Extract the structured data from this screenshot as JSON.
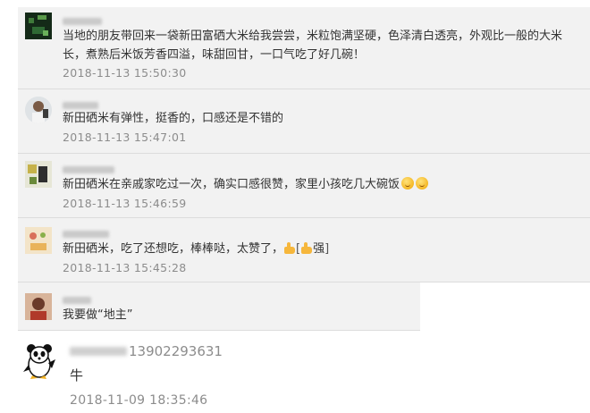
{
  "comments": [
    {
      "text": "当地的朋友带回来一袋新田富硒大米给我尝尝，米粒饱满坚硬，色泽清白透亮，外观比一般的大米长，煮熟后米饭芳香四溢，味甜回甘，一口气吃了好几碗！",
      "time": "2018-11-13 15:50:30"
    },
    {
      "text": "新田硒米有弹性，挺香的，口感还是不错的",
      "time": "2018-11-13 15:47:01"
    },
    {
      "text": "新田硒米在亲戚家吃过一次，确实口感很赞，家里小孩吃几大碗饭",
      "time": "2018-11-13 15:46:59"
    },
    {
      "text": "新田硒米，吃了还想吃，棒棒哒，太赞了，",
      "reaction_text": "强",
      "time": "2018-11-13 15:45:28"
    },
    {
      "text": "我要做“地主”",
      "time": ""
    }
  ],
  "last_comment": {
    "phone": "13902293631",
    "text": "牛",
    "time": "2018-11-09 18:35:46"
  }
}
